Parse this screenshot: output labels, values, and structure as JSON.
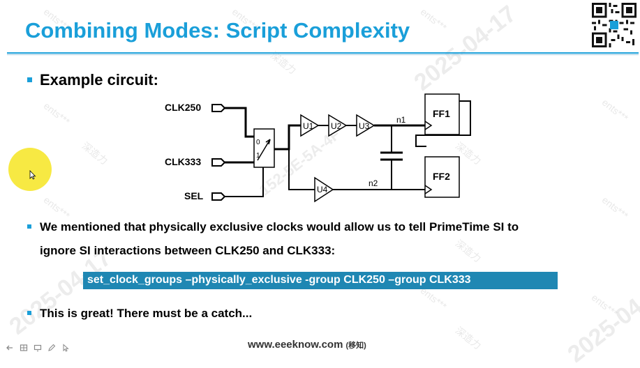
{
  "slide": {
    "title": "Combining Modes: Script Complexity",
    "bullet1": "Example circuit:",
    "bullet2_line1": "We mentioned that physically exclusive clocks would allow us to tell PrimeTime SI to",
    "bullet2_line2": "ignore SI interactions between CLK250 and CLK333:",
    "command": "set_clock_groups –physically_exclusive  -group CLK250 –group CLK333",
    "bullet3": "This is great! There must be a catch...",
    "footer": "www.eeeknow.com",
    "footer_suffix": "(移知)"
  },
  "circuit": {
    "inputs": [
      "CLK250",
      "CLK333",
      "SEL"
    ],
    "mux_inputs": [
      "0",
      "1"
    ],
    "buffers": [
      "U1",
      "U2",
      "U3",
      "U4"
    ],
    "nets": [
      "n1",
      "n2"
    ],
    "flops": [
      "FF1",
      "FF2"
    ]
  },
  "watermarks": [
    "ents***",
    "深造力",
    "2025-04-17",
    "152-5E-5A-4F"
  ],
  "toolbar": {
    "icons": [
      "arrow-icon",
      "grid-icon",
      "slideshow-icon",
      "pen-icon",
      "cursor-icon"
    ]
  },
  "colors": {
    "accent": "#1a9fd9",
    "command_bg": "#1f87b3",
    "pointer_highlight": "#f6e733"
  }
}
